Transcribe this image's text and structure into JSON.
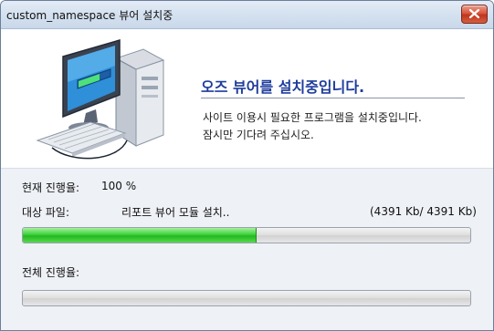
{
  "window": {
    "title": "custom_namespace  뷰어 설치중"
  },
  "header": {
    "headline": "오즈 뷰어를 설치중입니다.",
    "description_lines": [
      "사이트 이용시 필요한 프로그램을 설치중입니다.",
      "잠시만 기다려 주십시오."
    ],
    "icon": "computer-install-icon"
  },
  "current": {
    "progress_label": "현재 진행율:",
    "progress_percent_text": "100 %",
    "target_label": "대상 파일:",
    "target_file": "리포트 뷰어 모듈 설치..",
    "size_text": "(4391 Kb/ 4391 Kb)",
    "bar_fraction": 0.52
  },
  "total": {
    "progress_label": "전체 진행율:",
    "bar_fraction": 0
  },
  "colors": {
    "headline": "#1f3c9b",
    "progress_fill": "#3ed23a",
    "close_button": "#d9573d"
  }
}
